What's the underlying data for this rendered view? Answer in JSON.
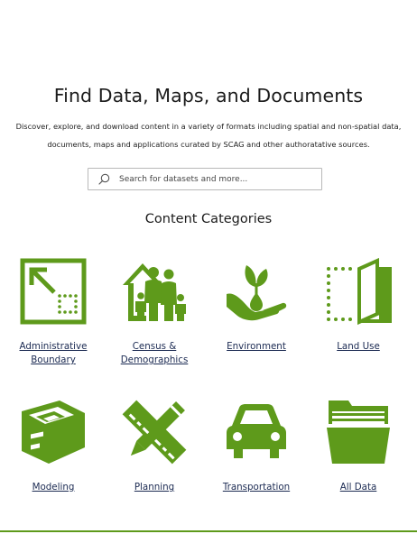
{
  "page": {
    "title": "Find Data, Maps, and Documents",
    "description": "Discover, explore, and download content in a variety of formats including spatial and non-spatial data, documents, maps and applications curated by SCAG and other authoratative sources."
  },
  "search": {
    "placeholder": "Search for datasets and more...",
    "value": "",
    "icon": "search-icon"
  },
  "categories": {
    "heading": "Content Categories",
    "accent_color": "#5e9a1b",
    "items": [
      {
        "label": "Administrative Boundary",
        "icon": "boundary-icon"
      },
      {
        "label": "Census & Demographics",
        "icon": "family-house-icon"
      },
      {
        "label": "Environment",
        "icon": "plant-hand-icon"
      },
      {
        "label": "Land Use",
        "icon": "map-fold-icon"
      },
      {
        "label": "Modeling",
        "icon": "model-box-icon"
      },
      {
        "label": "Planning",
        "icon": "ruler-pencil-icon"
      },
      {
        "label": "Transportation",
        "icon": "car-icon"
      },
      {
        "label": "All Data",
        "icon": "file-drawer-icon"
      }
    ]
  }
}
